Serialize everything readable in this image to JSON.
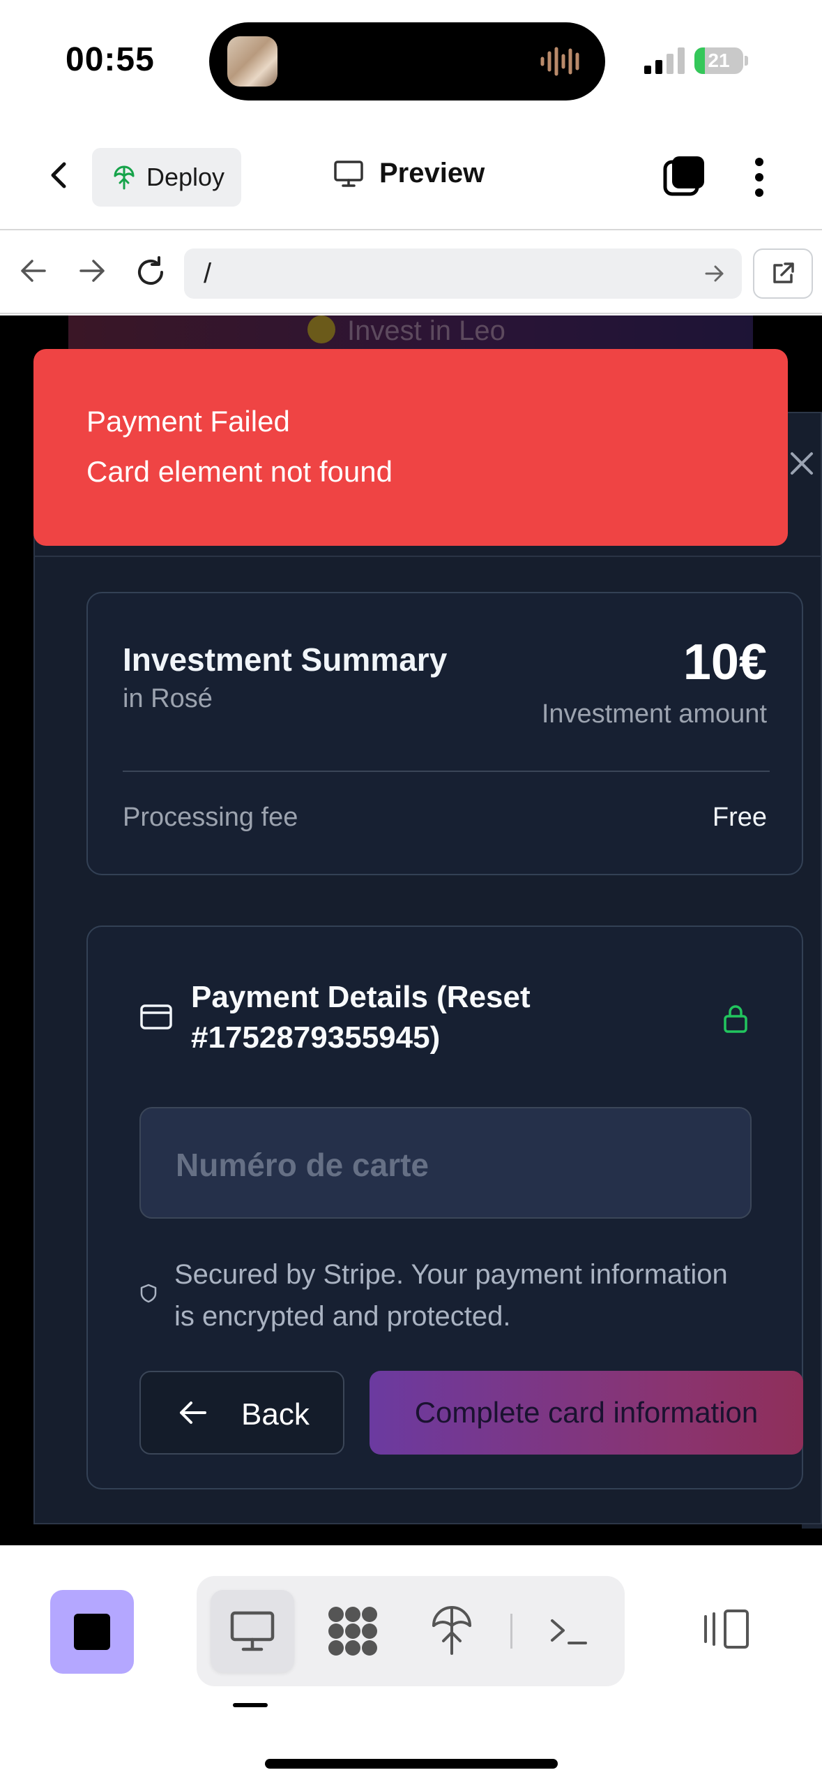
{
  "status": {
    "time": "00:55",
    "battery": "21"
  },
  "header": {
    "deploy_label": "Deploy",
    "preview_label": "Preview"
  },
  "url_bar": {
    "path": "/"
  },
  "background_page": {
    "banner_text": "Invest in Leo"
  },
  "toast": {
    "title": "Payment Failed",
    "message": "Card element not found"
  },
  "summary": {
    "title": "Investment Summary",
    "subtitle": "in Rosé",
    "amount": "10€",
    "amount_label": "Investment amount",
    "fee_label": "Processing fee",
    "fee_value": "Free"
  },
  "payment": {
    "title": "Payment Details (Reset #1752879355945)",
    "card_placeholder": "Numéro de carte",
    "secure_text": "Secured by Stripe. Your payment information is encrypted and protected.",
    "back_label": "Back",
    "complete_label": "Complete card information"
  },
  "colors": {
    "toast_red": "#ef4444",
    "modal_bg": "#161e2d",
    "lock_green": "#22c55e",
    "stop_purple": "#b4a7ff",
    "battery_green": "#34c759"
  },
  "icons": {
    "toolbar": [
      "monitor-icon",
      "grid-icon",
      "deploy-icon",
      "terminal-icon"
    ],
    "side": "side-panel-icon"
  }
}
